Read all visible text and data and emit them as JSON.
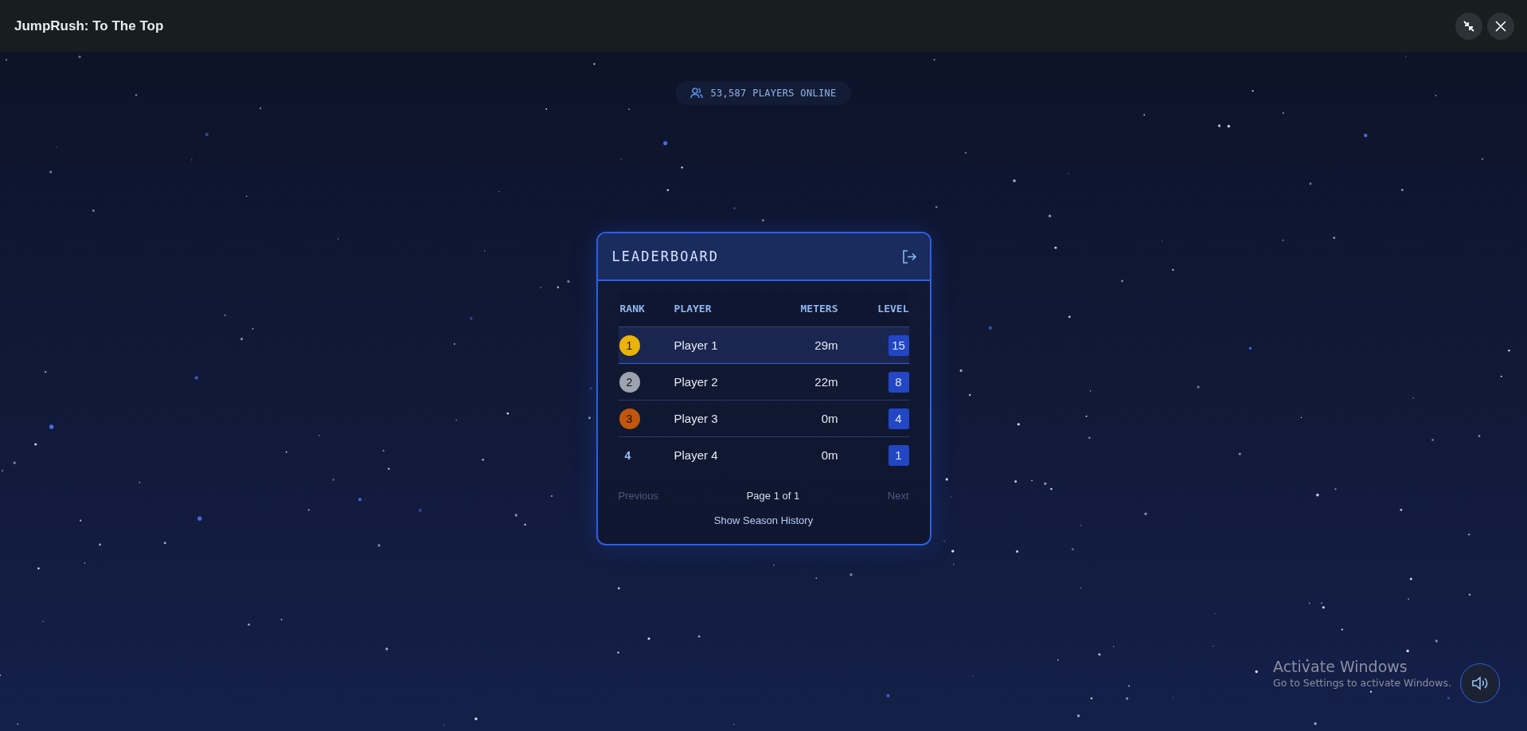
{
  "window": {
    "title": "JumpRush: To The Top"
  },
  "online": {
    "text": "53,587 PLAYERS ONLINE"
  },
  "leaderboard": {
    "title": "LEADERBOARD",
    "columns": [
      "RANK",
      "PLAYER",
      "METERS",
      "LEVEL"
    ],
    "rows": [
      {
        "rank": "1",
        "kind": "medal",
        "color": "#eab308",
        "player": "Player 1",
        "meters": "29m",
        "level": "15",
        "selected": true
      },
      {
        "rank": "2",
        "kind": "medal",
        "color": "#9ca3af",
        "player": "Player 2",
        "meters": "22m",
        "level": "8",
        "selected": false
      },
      {
        "rank": "3",
        "kind": "medal",
        "color": "#c2560c",
        "player": "Player 3",
        "meters": "0m",
        "level": "4",
        "selected": false
      },
      {
        "rank": "4",
        "kind": "plain",
        "player": "Player 4",
        "meters": "0m",
        "level": "1",
        "selected": false
      }
    ],
    "pagination": {
      "previous": {
        "label": "Previous",
        "disabled": true
      },
      "page": "Page 1 of 1",
      "next": {
        "label": "Next",
        "disabled": true
      }
    },
    "history_link": "Show Season History"
  },
  "activation": {
    "title": "Activate Windows",
    "subtitle": "Go to Settings to activate Windows."
  }
}
